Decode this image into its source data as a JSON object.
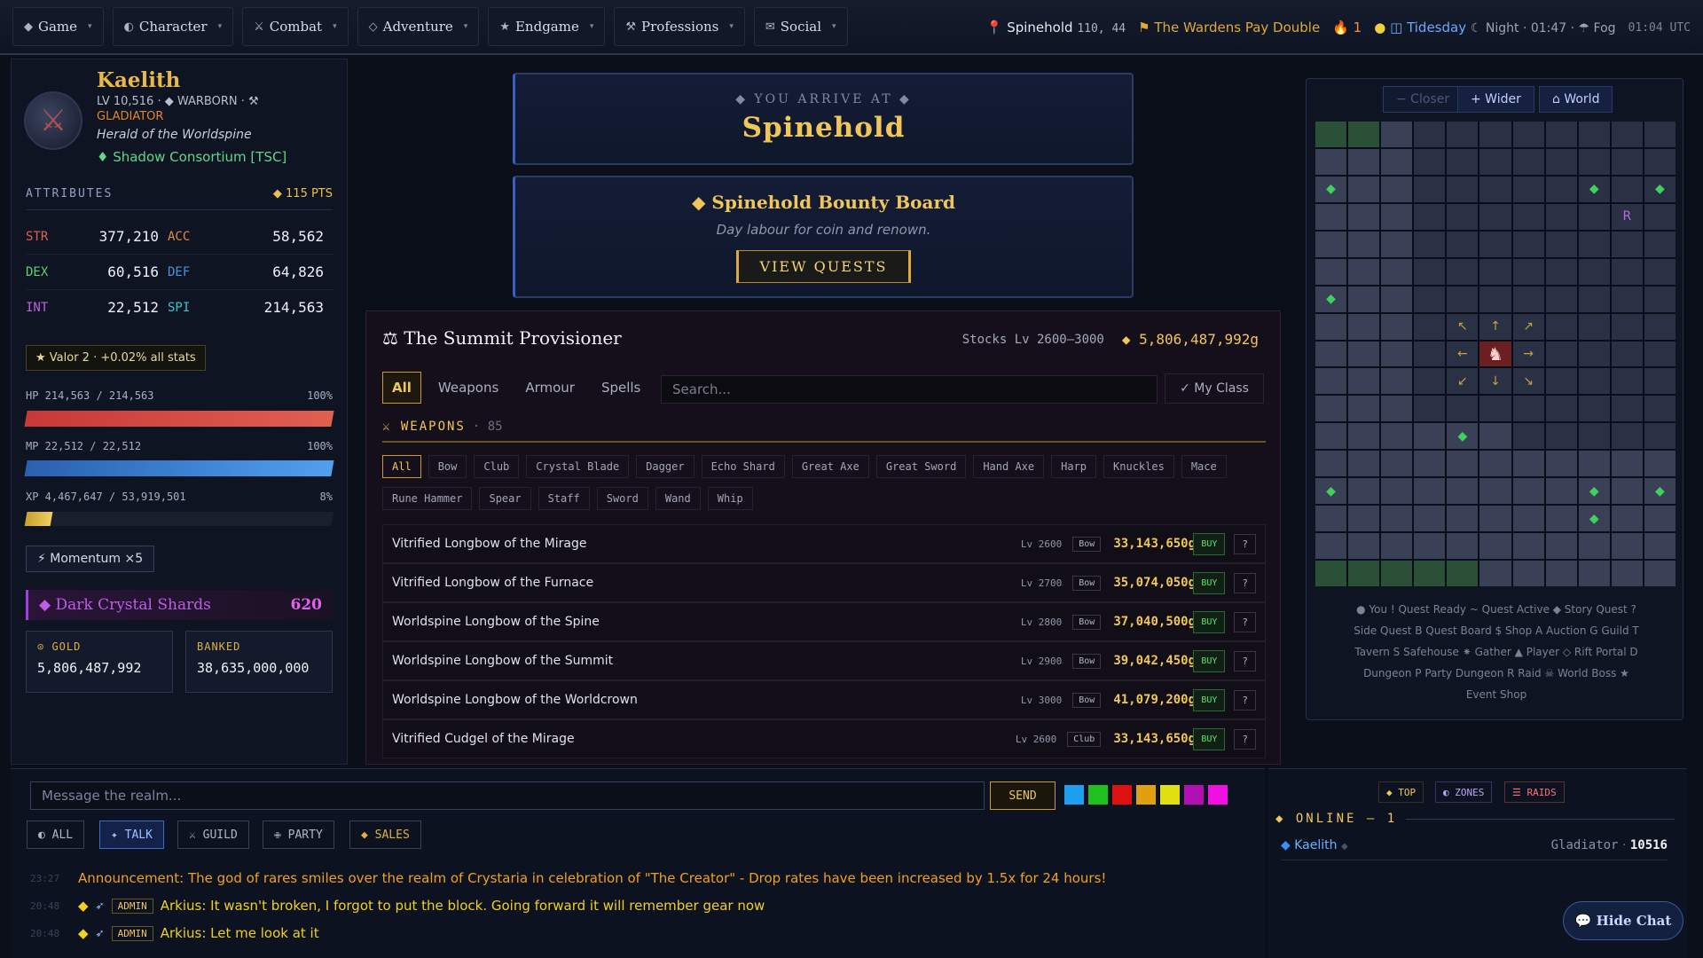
{
  "nav": {
    "items": [
      {
        "icon": "◆",
        "label": "Game"
      },
      {
        "icon": "◐",
        "label": "Character"
      },
      {
        "icon": "⚔",
        "label": "Combat"
      },
      {
        "icon": "◇",
        "label": "Adventure"
      },
      {
        "icon": "★",
        "label": "Endgame"
      },
      {
        "icon": "⚒",
        "label": "Professions"
      },
      {
        "icon": "✉",
        "label": "Social"
      }
    ],
    "location": "Spinehold",
    "coords": "110, 44",
    "event": "The Wardens Pay Double",
    "flame_count": "1",
    "day": "Tidesday",
    "time": "☾ Night · 01:47 · ☂ Fog",
    "utc": "01:04 UTC"
  },
  "character": {
    "name": "Kaelith",
    "line": "LV 10,516 · ◆ WARBORN · ⚒",
    "class": "GLADIATOR",
    "title": "Herald of the Worldspine",
    "guild": "♦ Shadow Consortium [TSC]"
  },
  "attributes": {
    "heading": "ATTRIBUTES",
    "points": "◆ 115 PTS",
    "rows": [
      {
        "k1": "STR",
        "v1": "377,210",
        "k2": "ACC",
        "v2": "58,562"
      },
      {
        "k1": "DEX",
        "v1": "60,516",
        "k2": "DEF",
        "v2": "64,826"
      },
      {
        "k1": "INT",
        "v1": "22,512",
        "k2": "SPI",
        "v2": "214,563"
      }
    ],
    "colors": {
      "STR": "#e06050",
      "DEX": "#5ad070",
      "INT": "#c060e0",
      "ACC": "#e08a40",
      "DEF": "#4a90e0",
      "SPI": "#40c0d0"
    }
  },
  "valor": "★ Valor 2 · +0.02% all stats",
  "bars": {
    "hp": {
      "label": "HP 214,563 / 214,563",
      "pct_label": "100%",
      "fraction": 1.0
    },
    "mp": {
      "label": "MP 22,512 / 22,512",
      "pct_label": "100%",
      "fraction": 1.0
    },
    "xp": {
      "label": "XP 4,467,647 / 53,919,501",
      "pct_label": "8%",
      "fraction": 0.083
    }
  },
  "momentum": "⚡ Momentum ×5",
  "shards": {
    "label": "◆ Dark Crystal Shards",
    "value": "620"
  },
  "gold": {
    "label": "⊙ GOLD",
    "value": "5,806,487,992"
  },
  "banked": {
    "label": "BANKED",
    "value": "38,635,000,000"
  },
  "arrive": {
    "sub": "◆ YOU ARRIVE AT ◆",
    "name": "Spinehold"
  },
  "bounty": {
    "title": "◆ Spinehold Bounty Board",
    "desc": "Day labour for coin and renown.",
    "button": "VIEW QUESTS"
  },
  "shop": {
    "title": "⚖ The Summit Provisioner",
    "stocks": "Stocks Lv 2600–3000",
    "gold": "◆ 5,806,487,992g",
    "tabs": [
      "All",
      "Weapons",
      "Armour",
      "Spells"
    ],
    "search_placeholder": "Search...",
    "my_class": "✓ My Class",
    "section": "⚔ WEAPONS",
    "section_count": "· 85",
    "subtabs": [
      "All",
      "Bow",
      "Club",
      "Crystal Blade",
      "Dagger",
      "Echo Shard",
      "Great Axe",
      "Great Sword",
      "Hand Axe",
      "Harp",
      "Knuckles",
      "Mace",
      "Rune Hammer",
      "Spear",
      "Staff",
      "Sword",
      "Wand",
      "Whip"
    ],
    "items": [
      {
        "name": "Vitrified Longbow of the Mirage",
        "lv": "Lv 2600",
        "type": "Bow",
        "price": "33,143,650g",
        "buy": "BUY",
        "q": "?"
      },
      {
        "name": "Vitrified Longbow of the Furnace",
        "lv": "Lv 2700",
        "type": "Bow",
        "price": "35,074,050g",
        "buy": "BUY",
        "q": "?"
      },
      {
        "name": "Worldspine Longbow of the Spine",
        "lv": "Lv 2800",
        "type": "Bow",
        "price": "37,040,500g",
        "buy": "BUY",
        "q": "?"
      },
      {
        "name": "Worldspine Longbow of the Summit",
        "lv": "Lv 2900",
        "type": "Bow",
        "price": "39,042,450g",
        "buy": "BUY",
        "q": "?"
      },
      {
        "name": "Worldspine Longbow of the Worldcrown",
        "lv": "Lv 3000",
        "type": "Bow",
        "price": "41,079,200g",
        "buy": "BUY",
        "q": "?"
      },
      {
        "name": "Vitrified Cudgel of the Mirage",
        "lv": "Lv 2600",
        "type": "Club",
        "price": "33,143,650g",
        "buy": "BUY",
        "q": "?"
      }
    ]
  },
  "map": {
    "buttons": [
      "− Closer",
      "+ Wider",
      "⌂ World"
    ],
    "legend_rows": [
      "● You  ! Quest Ready  ~ Quest Active  ◆ Story Quest  ?",
      "Side Quest  B Quest Board  $ Shop  A Auction  G Guild  T",
      "Tavern  S Safehouse  ⁕ Gather  ▲ Player  ◇ Rift Portal  D",
      "Dungeon  P Party Dungeon  R Raid  ☠ World Boss  ★",
      "Event Shop"
    ]
  },
  "chat": {
    "placeholder": "Message the realm...",
    "send": "SEND",
    "swatches": [
      "#1ea0f0",
      "#20c020",
      "#e01010",
      "#e0a010",
      "#e0e010",
      "#b010b0",
      "#f010e0"
    ],
    "tabs": [
      "◐ ALL",
      "✦ TALK",
      "⚔ GUILD",
      "✙ PARTY",
      "◆ SALES"
    ],
    "messages": [
      {
        "time": "23:27",
        "text": "Announcement: The god of rares smiles over the realm of Crystaria in celebration of \"The Creator\" - Drop rates have been increased by 1.5x for 24 hours!"
      },
      {
        "time": "20:48",
        "badge": "ADMIN",
        "text": "Arkius: It wasn't broken, I forgot to put the block. Going forward it will remember gear now"
      },
      {
        "time": "20:48",
        "badge": "ADMIN",
        "text": "Arkius: Let me look at it"
      }
    ]
  },
  "online": {
    "tabs": [
      "◆ TOP",
      "◐ ZONES",
      "☰ RAIDS"
    ],
    "heading": "◆ ONLINE — 1",
    "player": {
      "name": "Kaelith",
      "class": "Gladiator",
      "level": "10516"
    }
  },
  "hide_chat": "💬 Hide Chat"
}
